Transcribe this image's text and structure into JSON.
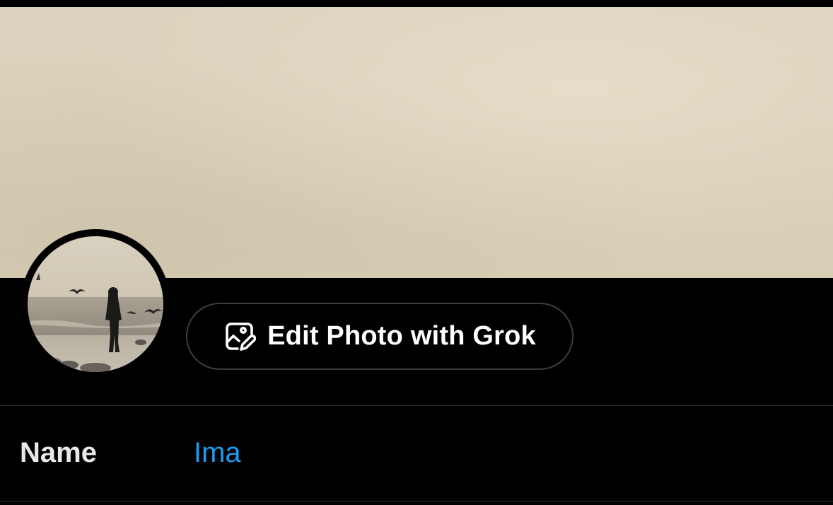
{
  "profile": {
    "banner": {
      "description_color": "#dcd2bc"
    },
    "avatar": {
      "icon": "avatar-photo"
    },
    "edit_photo_button": {
      "label": "Edit Photo with Grok",
      "icon": "image-edit-icon"
    },
    "name_field": {
      "label": "Name",
      "value": "Ima"
    }
  },
  "colors": {
    "background": "#000000",
    "accent": "#1d9bf0",
    "text_primary": "#e7e9ea",
    "button_border": "#3a3d42",
    "divider": "#2f3336"
  }
}
